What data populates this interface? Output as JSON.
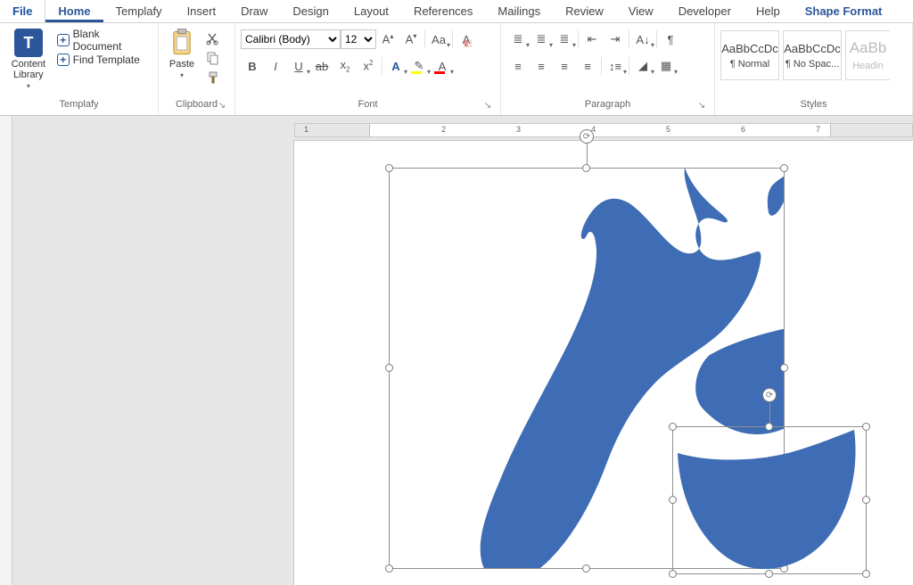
{
  "tabs": {
    "file": "File",
    "home": "Home",
    "templafy": "Templafy",
    "insert": "Insert",
    "draw": "Draw",
    "design": "Design",
    "layout": "Layout",
    "references": "References",
    "mailings": "Mailings",
    "review": "Review",
    "view": "View",
    "developer": "Developer",
    "help": "Help",
    "shape_format": "Shape Format"
  },
  "templafy": {
    "content_library": "Content\nLibrary",
    "blank_document": "Blank Document",
    "find_template": "Find Template",
    "group_label": "Templafy"
  },
  "clipboard": {
    "paste": "Paste",
    "group_label": "Clipboard"
  },
  "font": {
    "name_value": "Calibri (Body)",
    "size_value": "12",
    "group_label": "Font"
  },
  "paragraph": {
    "group_label": "Paragraph"
  },
  "styles": {
    "group_label": "Styles",
    "items": [
      {
        "sample": "AaBbCcDc",
        "name": "¶ Normal"
      },
      {
        "sample": "AaBbCcDc",
        "name": "¶ No Spac..."
      },
      {
        "sample": "AaBb",
        "name": "Headin"
      }
    ]
  },
  "ruler_numbers": [
    "1",
    "2",
    "3",
    "4",
    "5",
    "6",
    "7"
  ],
  "shape_color": "#3e6db5"
}
